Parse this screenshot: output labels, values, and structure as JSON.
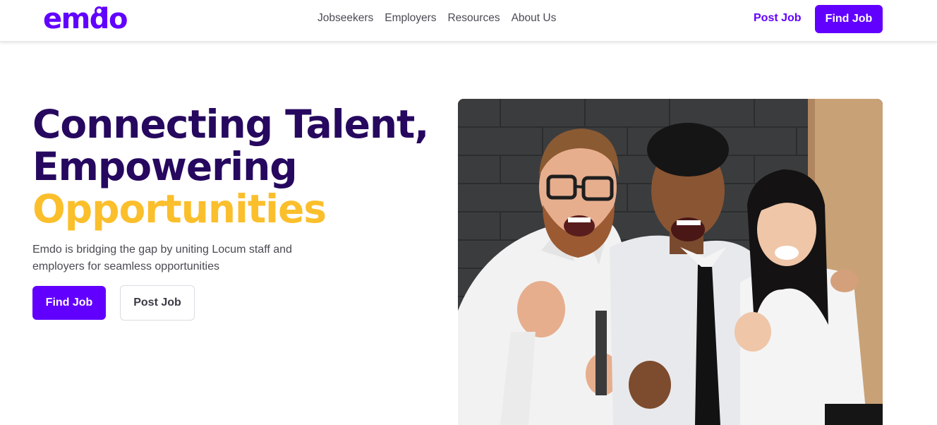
{
  "brand": {
    "logo_text": "emdo",
    "primary_color": "#6200ff",
    "dark_heading_color": "#26085f",
    "accent_color": "#fbbf2c"
  },
  "nav": {
    "items": [
      "Jobseekers",
      "Employers",
      "Resources",
      "About Us"
    ],
    "post_job_label": "Post Job",
    "find_job_label": "Find Job"
  },
  "hero": {
    "headline_line1": "Connecting Talent,",
    "headline_line2": "Empowering",
    "headline_line3": "Opportunities",
    "subtext": "Emdo is bridging the gap by uniting Locum staff and employers for seamless opportunities",
    "find_job_label": "Find Job",
    "post_job_label": "Post Job",
    "image_subject": "three-excited-office-workers-photo"
  }
}
